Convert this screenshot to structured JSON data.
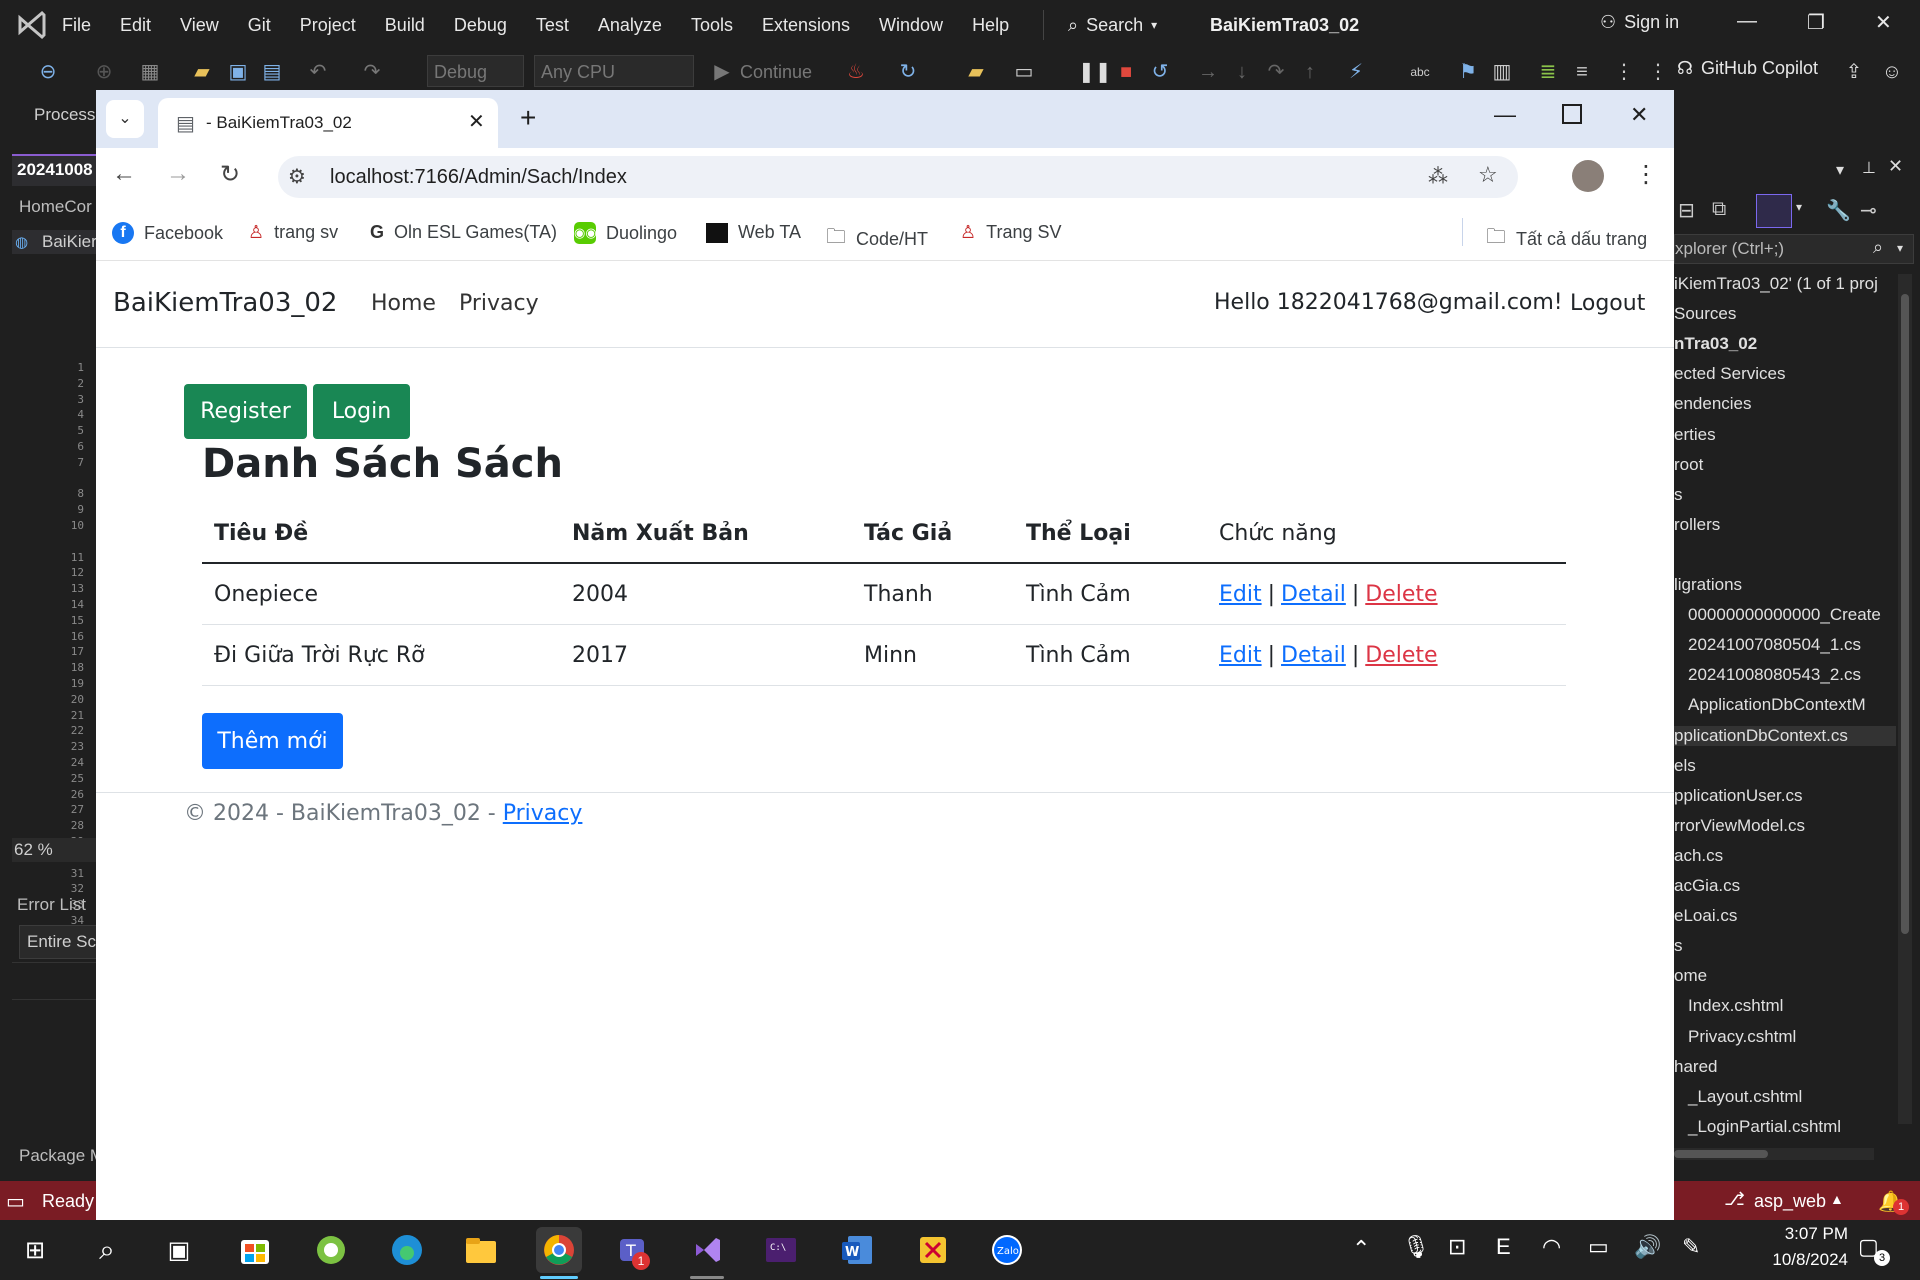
{
  "vs": {
    "menu": [
      "File",
      "Edit",
      "View",
      "Git",
      "Project",
      "Build",
      "Debug",
      "Test",
      "Analyze",
      "Tools",
      "Extensions",
      "Window",
      "Help"
    ],
    "search_label": "Search",
    "solution_title": "BaiKiemTra03_02",
    "sign_in": "Sign in",
    "toolbar": {
      "config": "Debug",
      "platform": "Any CPU",
      "continue": "Continue",
      "copilot": "GitHub Copilot"
    },
    "left": {
      "process": "Process",
      "doc_tab": "20241008",
      "home_tab": "HomeCor",
      "project_tab": "BaiKier",
      "zoom": "62 %",
      "error_list": "Error List",
      "entire_sc": "Entire Sc",
      "package": "Package M",
      "line_numbers": [
        "1",
        "2",
        "3",
        "4",
        "5",
        "6",
        "7",
        "",
        "8",
        "9",
        "10",
        "",
        "11",
        "12",
        "13",
        "14",
        "15",
        "16",
        "17",
        "18",
        "19",
        "20",
        "21",
        "22",
        "23",
        "24",
        "25",
        "26",
        "27",
        "28",
        "29",
        "30",
        "31",
        "32",
        "33",
        "34"
      ]
    },
    "solution_explorer": {
      "search_placeholder": "xplorer (Ctrl+;)",
      "items": [
        "iKiemTra03_02' (1 of 1 proj",
        "Sources",
        "nTra03_02",
        "ected Services",
        "endencies",
        "erties",
        "root",
        "s",
        "rollers",
        "",
        "ligrations",
        "00000000000000_Create",
        "20241007080504_1.cs",
        "20241008080543_2.cs",
        "ApplicationDbContextM",
        "pplicationDbContext.cs",
        "els",
        "pplicationUser.cs",
        "rrorViewModel.cs",
        "ach.cs",
        "acGia.cs",
        "eLoai.cs",
        "s",
        "ome",
        "Index.cshtml",
        "Privacy.cshtml",
        "hared",
        "_Layout.cshtml",
        "_LoginPartial.cshtml"
      ]
    },
    "status": {
      "ready": "Ready",
      "branch": "asp_web",
      "notifications": "1"
    }
  },
  "taskbar": {
    "time": "3:07 PM",
    "date": "10/8/2024",
    "notif_count": "3",
    "teams_badge": "1"
  },
  "chrome": {
    "tab_title": "- BaiKiemTra03_02",
    "url": "localhost:7166/Admin/Sach/Index",
    "bookmarks": [
      "Facebook",
      "trang sv",
      "Oln ESL Games(TA)",
      "Duolingo",
      "Web TA",
      "Code/HT",
      "Trang SV"
    ],
    "all_bookmarks": "Tất cả dấu trang"
  },
  "page": {
    "brand": "BaiKiemTra03_02",
    "nav": [
      "Home",
      "Privacy"
    ],
    "hello": "Hello 1822041768@gmail.com!",
    "logout": "Logout",
    "register": "Register",
    "login": "Login",
    "heading": "Danh Sách Sách",
    "columns": [
      "Tiêu Đề",
      "Năm Xuất Bản",
      "Tác Giả",
      "Thể Loại",
      "Chức năng"
    ],
    "rows": [
      {
        "title": "Onepiece",
        "year": "2004",
        "author": "Thanh",
        "genre": "Tình Cảm"
      },
      {
        "title": "Đi Giữa Trời Rực Rỡ",
        "year": "2017",
        "author": "Minn",
        "genre": "Tình Cảm"
      }
    ],
    "actions": {
      "edit": "Edit",
      "detail": "Detail",
      "delete": "Delete",
      "sep": "|"
    },
    "add_new": "Thêm mới",
    "footer_text": "© 2024 - BaiKiemTra03_02 - ",
    "footer_link": "Privacy"
  },
  "colors": {
    "green": "#198754",
    "blue": "#0d6efd",
    "red": "#dc3545",
    "status_bar": "#7a1c24"
  }
}
